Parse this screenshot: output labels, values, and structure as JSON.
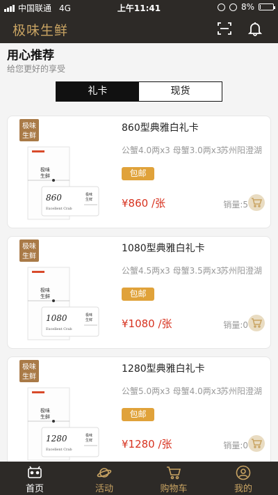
{
  "status_bar": {
    "carrier": "中国联通",
    "network": "4G",
    "time": "上午11:41",
    "battery": "8%",
    "battery_level": 0.08
  },
  "header": {
    "logo": "极味生鲜",
    "icons": [
      "scan-icon",
      "bell-icon"
    ]
  },
  "section": {
    "title": "用心推荐",
    "subtitle": "给您更好的享受"
  },
  "tabs": [
    {
      "label": "礼卡",
      "active": true
    },
    {
      "label": "现货",
      "active": false
    }
  ],
  "products": [
    {
      "title": "860型典雅白礼卡",
      "spec": "公蟹4.0两x3 母蟹3.0两x3",
      "origin": "苏州阳澄湖",
      "tag": "包邮",
      "price": "¥860 /张",
      "sold": "销量:5",
      "card_logo": "极味生鲜",
      "card_number": "860",
      "card_caption": "Excellent Crab"
    },
    {
      "title": "1080型典雅白礼卡",
      "spec": "公蟹4.5两x3 母蟹3.5两x3",
      "origin": "苏州阳澄湖",
      "tag": "包邮",
      "price": "¥1080 /张",
      "sold": "销量:0",
      "card_logo": "极味生鲜",
      "card_number": "1080",
      "card_caption": "Excellent Crab"
    },
    {
      "title": "1280型典雅白礼卡",
      "spec": "公蟹5.0两x3 母蟹4.0两x3",
      "origin": "苏州阳澄湖",
      "tag": "包邮",
      "price": "¥1280 /张",
      "sold": "销量:0",
      "card_logo": "极味生鲜",
      "card_number": "1280",
      "card_caption": "Excellent Crab"
    }
  ],
  "bottom_nav": [
    {
      "label": "首页",
      "icon": "home-icon",
      "active": true
    },
    {
      "label": "活动",
      "icon": "planet-icon",
      "active": false
    },
    {
      "label": "购物车",
      "icon": "cart-icon",
      "active": false
    },
    {
      "label": "我的",
      "icon": "user-icon",
      "active": false
    }
  ],
  "colors": {
    "header_bg": "#2d2a27",
    "accent_gold": "#c9a463",
    "tag_orange": "#e0a23a",
    "price_red": "#d7321f"
  }
}
